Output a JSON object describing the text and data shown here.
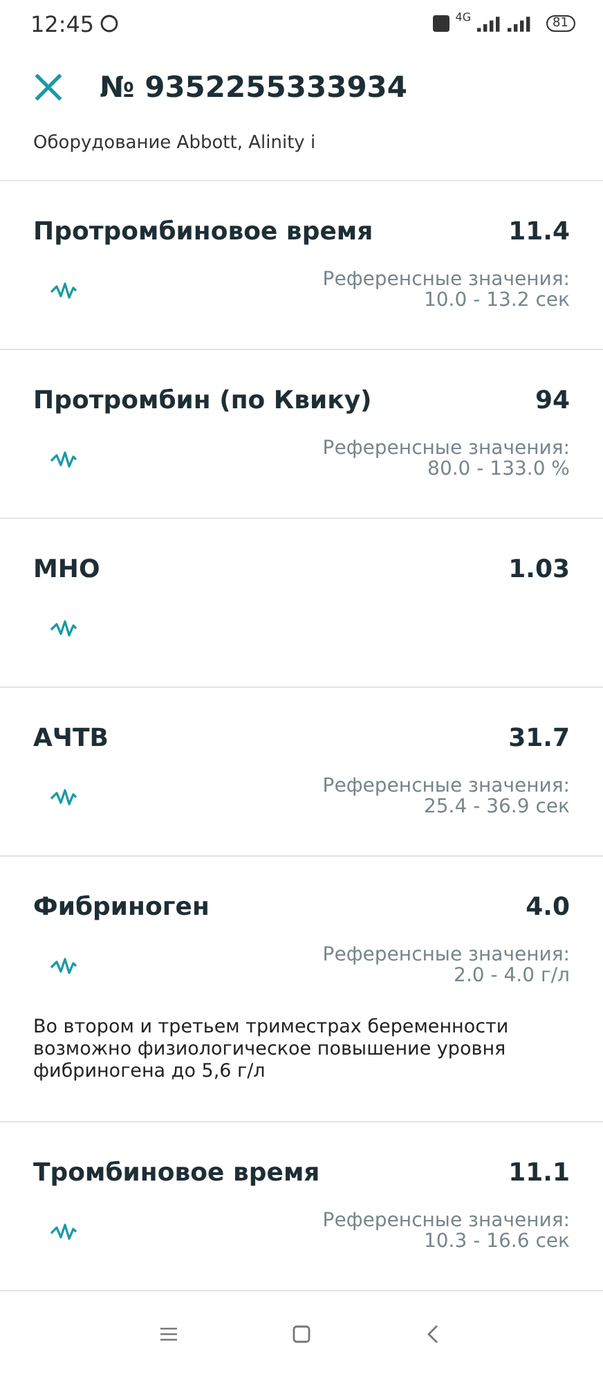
{
  "status_bar": {
    "time": "12:45",
    "network": "4G",
    "battery": "81"
  },
  "header": {
    "title": "№ 9352255333934"
  },
  "subtitle": "Оборудование Abbott, Alinity i",
  "tests": [
    {
      "name": "Протромбиновое время",
      "value": "11.4",
      "reference_label": "Референсные значения:",
      "reference_range": "10.0 - 13.2 сек"
    },
    {
      "name": "Протромбин (по Квику)",
      "value": "94",
      "reference_label": "Референсные значения:",
      "reference_range": "80.0 - 133.0 %"
    },
    {
      "name": "МНО",
      "value": "1.03"
    },
    {
      "name": "АЧТВ",
      "value": "31.7",
      "reference_label": "Референсные значения:",
      "reference_range": "25.4 - 36.9 сек"
    },
    {
      "name": "Фибриноген",
      "value": "4.0",
      "reference_label": "Референсные значения:",
      "reference_range": "2.0 - 4.0 г/л",
      "note": "Во втором и третьем триместрах беременности возможно физиологическое повышение уровня фибриногена до 5,6 г/л"
    },
    {
      "name": "Тромбиновое время",
      "value": "11.1",
      "reference_label": "Референсные значения:",
      "reference_range": "10.3 - 16.6 сек"
    }
  ]
}
